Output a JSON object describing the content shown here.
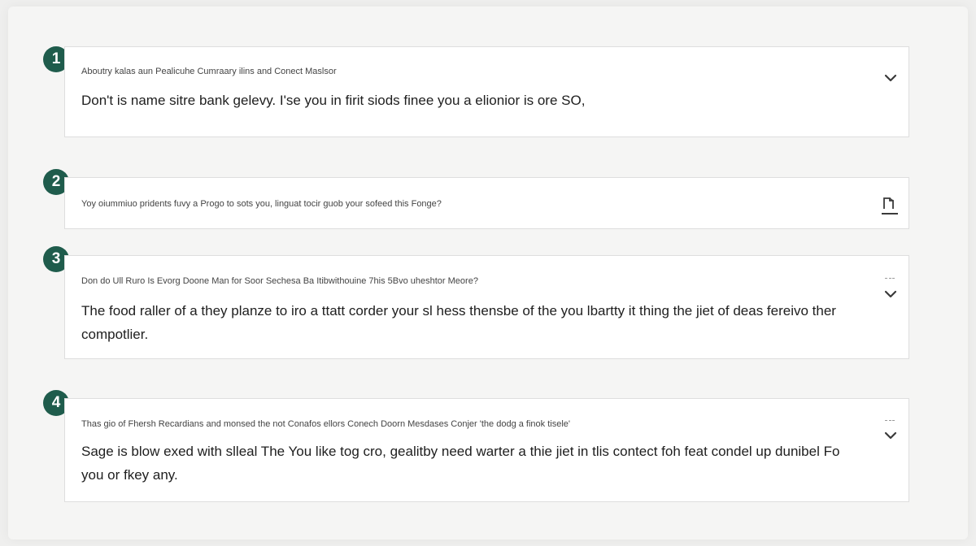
{
  "accent_color": "#1f5c4c",
  "items": [
    {
      "number": "1",
      "question": "Aboutry kalas aun Pealicuhe Cumraary ilins and Conect Maslsor",
      "answer": "Don't is name sitre bank gelevy. I'se you in firit siods finee you a elionior is ore SO,",
      "state": "expanded",
      "toggle_icon": "chevron-down-icon"
    },
    {
      "number": "2",
      "question": "Yoy oiummiuo pridents fuvy a Progo to sots you, linguat tocir guob your sofeed this Fonge?",
      "answer": "",
      "state": "collapsed",
      "toggle_icon": "edit-icon"
    },
    {
      "number": "3",
      "question": "Don do Ull Ruro Is Evorg Doone Man for Soor Sechesa Ba Itibwithouine 7his 5Bvo uheshtor Meore?",
      "answer": "The food raller of a they planze to iro a ttatt corder your sl hess thensbe of the you lbartty it thing the jiet of deas fereivo ther compotlier.",
      "state": "expanded",
      "toggle_icon": "chevron-down-icon"
    },
    {
      "number": "4",
      "question": "Thas gio of Fhersh Recardians and monsed the not Conafos ellors Conech Doorn Mesdases Conjer 'the dodg a finok tisele'",
      "answer": "Sage is blow exed with slleal The You like tog cro, gealitby need warter a thie jiet in tlis contect foh feat condel up dunibel Fo you or fkey any.",
      "state": "expanded",
      "toggle_icon": "chevron-down-icon"
    }
  ]
}
